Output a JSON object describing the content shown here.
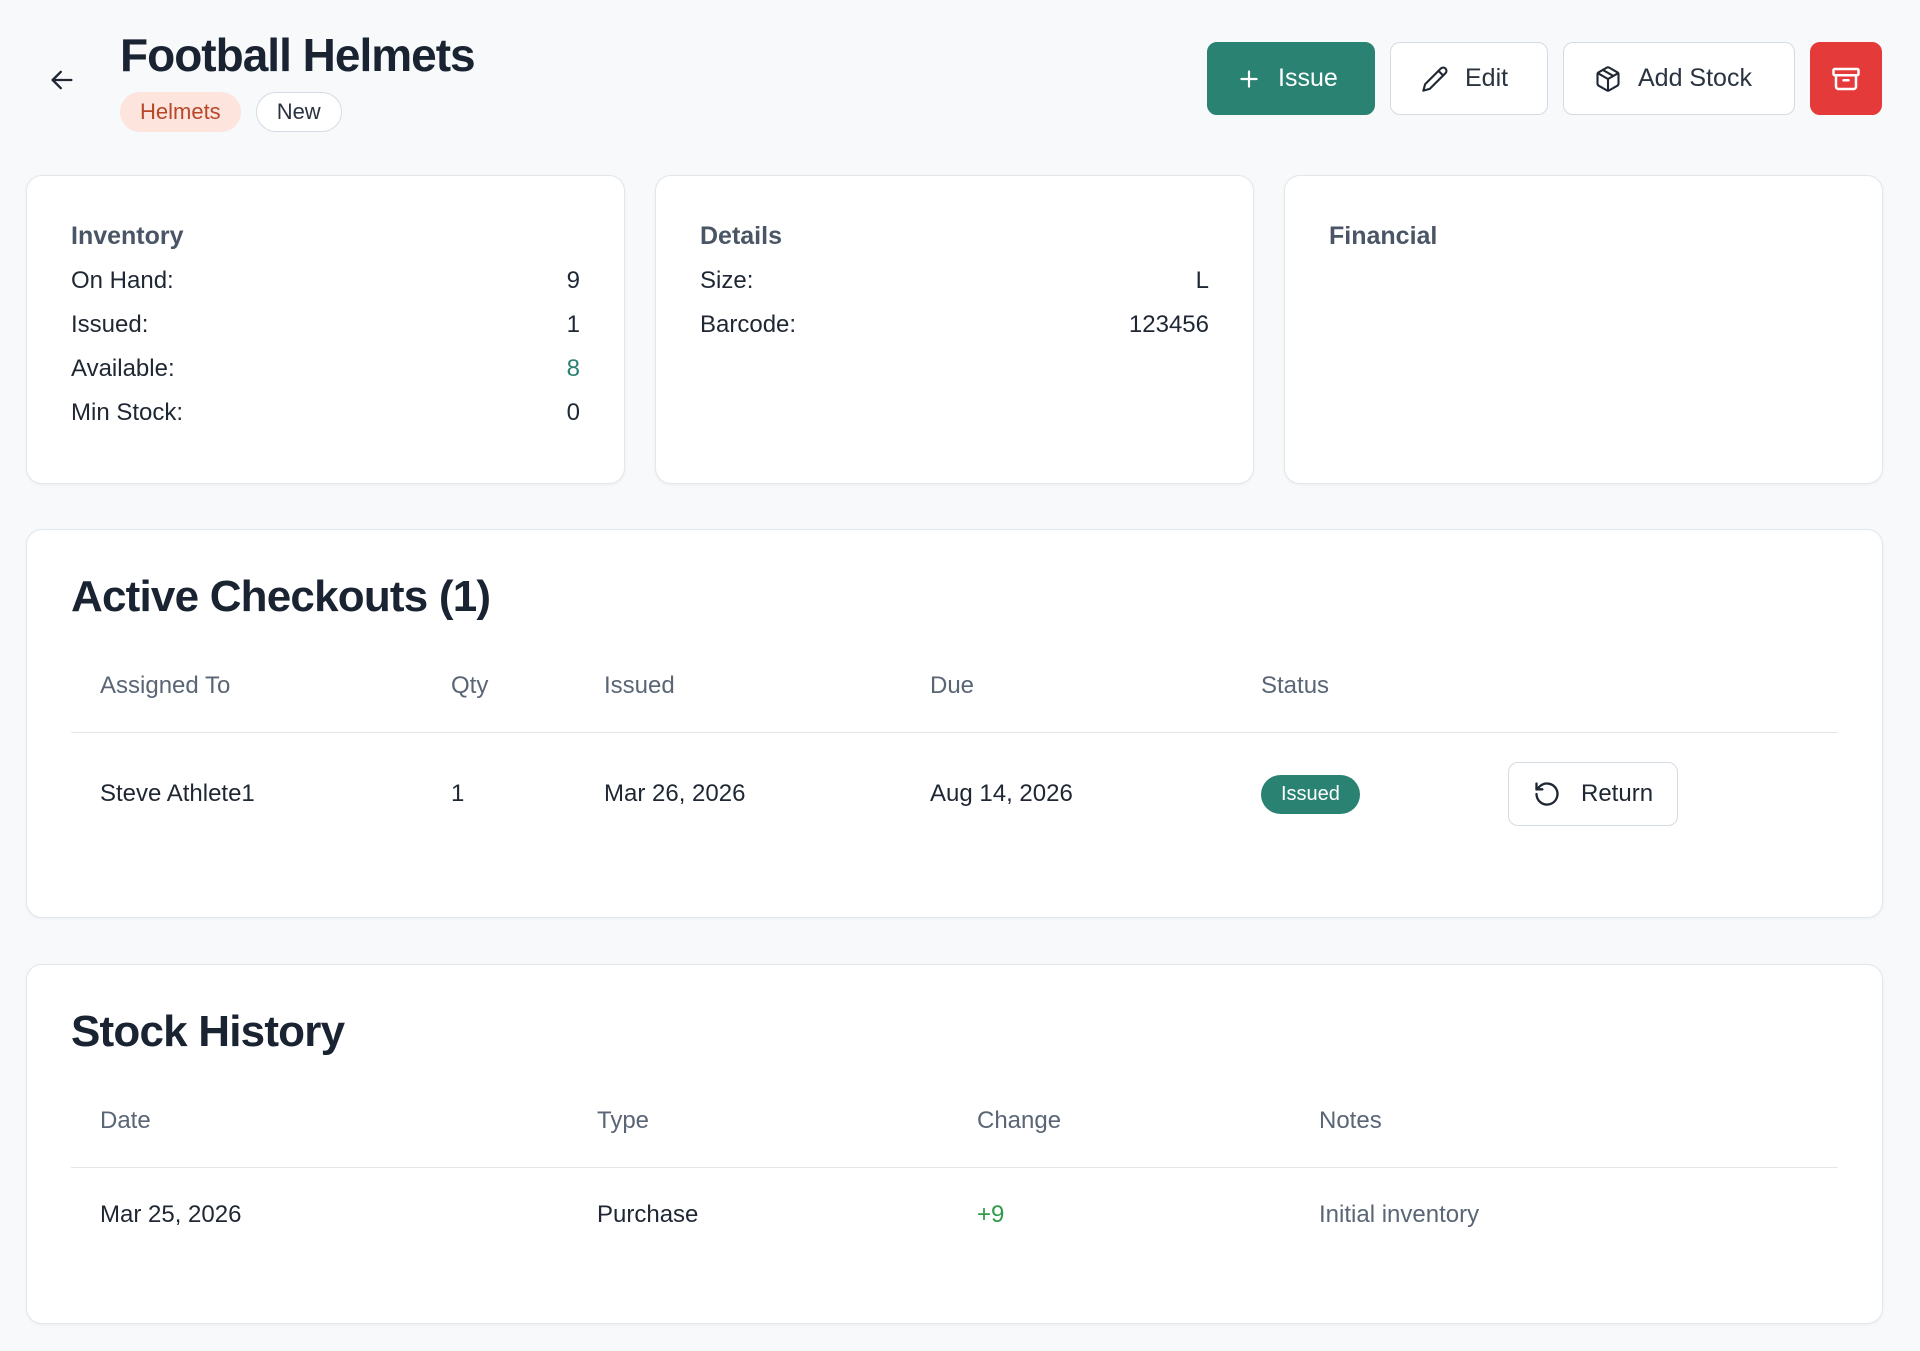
{
  "header": {
    "title": "Football Helmets",
    "badges": {
      "category": "Helmets",
      "condition": "New"
    },
    "actions": {
      "issue_label": "Issue",
      "edit_label": "Edit",
      "add_stock_label": "Add Stock"
    }
  },
  "colors": {
    "primary": "#2a8273",
    "danger": "#e53a3a",
    "category_badge_bg": "#fde4dc",
    "category_badge_text": "#b8472a",
    "positive": "#2f9a4a"
  },
  "inventory": {
    "title": "Inventory",
    "rows": [
      {
        "label": "On Hand:",
        "value": "9"
      },
      {
        "label": "Issued:",
        "value": "1"
      },
      {
        "label": "Available:",
        "value": "8"
      },
      {
        "label": "Min Stock:",
        "value": "0"
      }
    ]
  },
  "details": {
    "title": "Details",
    "rows": [
      {
        "label": "Size:",
        "value": "L"
      },
      {
        "label": "Barcode:",
        "value": "123456"
      }
    ]
  },
  "financial": {
    "title": "Financial"
  },
  "checkouts": {
    "title": "Active Checkouts (1)",
    "columns": [
      "Assigned To",
      "Qty",
      "Issued",
      "Due",
      "Status"
    ],
    "rows": [
      {
        "assigned_to": "Steve Athlete1",
        "qty": "1",
        "issued": "Mar 26, 2026",
        "due": "Aug 14, 2026",
        "status": "Issued",
        "action_label": "Return"
      }
    ]
  },
  "history": {
    "title": "Stock History",
    "columns": [
      "Date",
      "Type",
      "Change",
      "Notes"
    ],
    "rows": [
      {
        "date": "Mar 25, 2026",
        "type": "Purchase",
        "change": "+9",
        "notes": "Initial inventory"
      }
    ]
  },
  "icons": {
    "back": "arrow-left-icon",
    "issue": "plus-icon",
    "edit": "pencil-icon",
    "add_stock": "package-icon",
    "archive": "archive-icon",
    "return": "rotate-ccw-icon"
  }
}
